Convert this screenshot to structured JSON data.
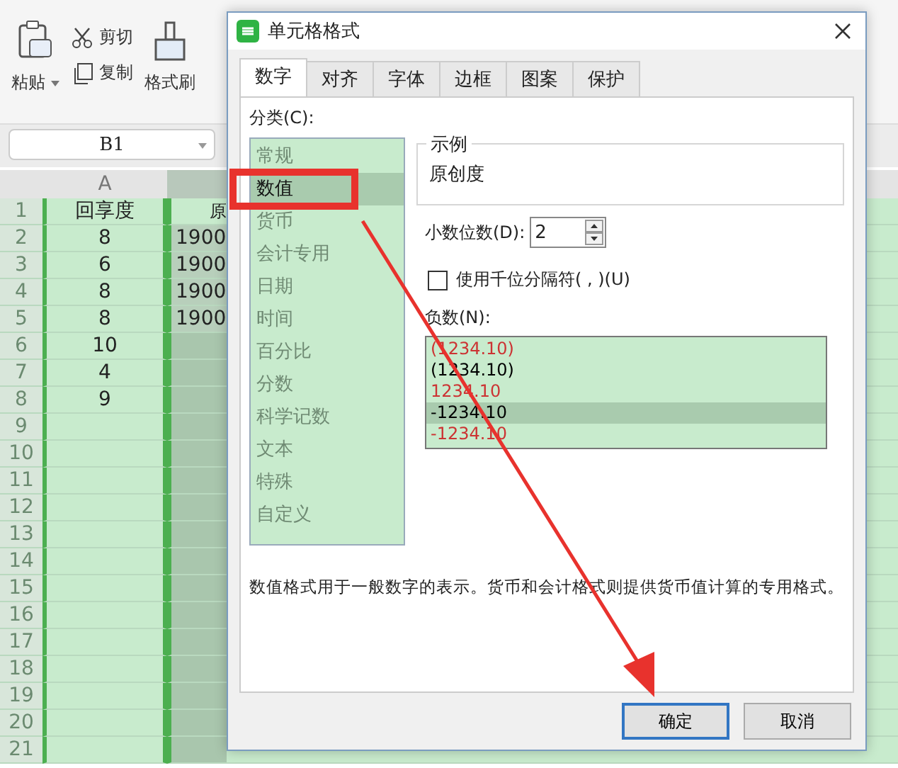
{
  "toolbar": {
    "items": [
      {
        "kind": "paste",
        "label": "粘贴"
      },
      {
        "kind": "cut",
        "label": "剪切"
      },
      {
        "kind": "copy",
        "label": "复制"
      },
      {
        "kind": "brush",
        "label": "格式刷"
      }
    ]
  },
  "name_box": "B1",
  "sheet": {
    "columns": [
      {
        "header": "A",
        "selected": false
      },
      {
        "selected": true
      }
    ],
    "rows": [
      {
        "number": "1",
        "cells": [
          "回享度",
          "原"
        ]
      },
      {
        "number": "2",
        "cells": [
          "8",
          "1900"
        ]
      },
      {
        "number": "3",
        "cells": [
          "6",
          "1900"
        ]
      },
      {
        "number": "4",
        "cells": [
          "8",
          "1900"
        ]
      },
      {
        "number": "5",
        "cells": [
          "8",
          "1900"
        ]
      },
      {
        "number": "6",
        "cells": [
          "10"
        ]
      },
      {
        "number": "7",
        "cells": [
          "4"
        ]
      },
      {
        "number": "8",
        "cells": [
          "9"
        ]
      },
      {
        "number": "9",
        "cells": []
      },
      {
        "number": "10",
        "cells": []
      },
      {
        "number": "11",
        "cells": []
      },
      {
        "number": "12",
        "cells": []
      },
      {
        "number": "13",
        "cells": []
      },
      {
        "number": "14",
        "cells": []
      },
      {
        "number": "15",
        "cells": []
      },
      {
        "number": "16",
        "cells": []
      },
      {
        "number": "17",
        "cells": []
      },
      {
        "number": "18",
        "cells": []
      },
      {
        "number": "19",
        "cells": []
      },
      {
        "number": "20",
        "cells": []
      },
      {
        "number": "21",
        "cells": []
      }
    ]
  },
  "dialog": {
    "title": "单元格格式",
    "tabs": [
      {
        "label": "数字",
        "selected": true
      },
      {
        "label": "对齐",
        "selected": false
      },
      {
        "label": "字体",
        "selected": false
      },
      {
        "label": "边框",
        "selected": false
      },
      {
        "label": "图案",
        "selected": false
      },
      {
        "label": "保护",
        "selected": false
      }
    ],
    "category_label": "分类(C):",
    "categories": [
      {
        "label": "常规",
        "selected": false
      },
      {
        "label": "数值",
        "selected": true
      },
      {
        "label": "货币",
        "selected": false
      },
      {
        "label": "会计专用",
        "selected": false
      },
      {
        "label": "日期",
        "selected": false
      },
      {
        "label": "时间",
        "selected": false
      },
      {
        "label": "百分比",
        "selected": false
      },
      {
        "label": "分数",
        "selected": false
      },
      {
        "label": "科学记数",
        "selected": false
      },
      {
        "label": "文本",
        "selected": false
      },
      {
        "label": "特殊",
        "selected": false
      },
      {
        "label": "自定义",
        "selected": false
      }
    ],
    "sample": {
      "label": "示例",
      "value": "原创度"
    },
    "decimals": {
      "label": "小数位数(D):",
      "value": "2"
    },
    "thousands": {
      "label": "使用千位分隔符( , )(U)",
      "checked": false
    },
    "negative": {
      "label": "负数(N):",
      "options": [
        {
          "label": "(1234.10)",
          "color": "#cc3333",
          "selected": false
        },
        {
          "label": "(1234.10)",
          "color": "#000000",
          "selected": false
        },
        {
          "label": "1234.10",
          "color": "#cc3333",
          "selected": false
        },
        {
          "label": "-1234.10",
          "color": "#000000",
          "selected": true
        },
        {
          "label": "-1234.10",
          "color": "#cc3333",
          "selected": false
        }
      ]
    },
    "description": "数值格式用于一般数字的表示。货币和会计格式则提供货币值计算的专用格式。",
    "buttons": [
      {
        "label": "确定",
        "default": true
      },
      {
        "label": "取消",
        "default": false
      }
    ]
  },
  "annotations": {
    "highlight_box": true,
    "arrow": true
  }
}
